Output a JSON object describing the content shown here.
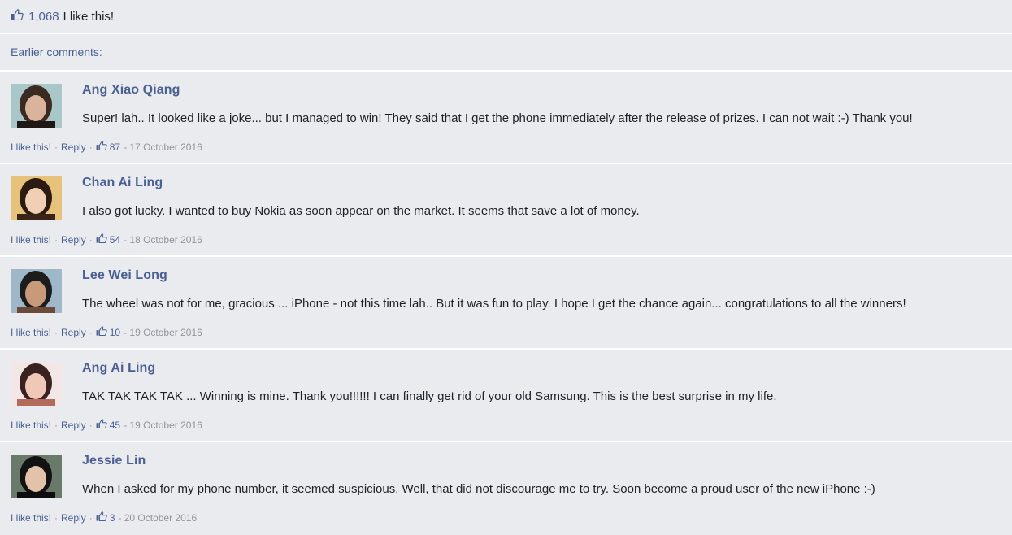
{
  "top_likes": {
    "count": "1,068",
    "text": "I like this!"
  },
  "earlier_label": "Earlier comments:",
  "comments": [
    {
      "name": "Ang Xiao Qiang",
      "text": "Super! lah.. It looked like a joke... but I managed to win! They said that I get the phone immediately after the release of prizes. I can not wait :-) Thank you!",
      "like_label": "I like this!",
      "reply_label": "Reply",
      "likes": "87",
      "date": "- 17 October 2016",
      "avatar_colors": [
        "#a9c6c9",
        "#3b2a22",
        "#d9b39b",
        "#1f1815"
      ]
    },
    {
      "name": "Chan Ai Ling",
      "text": "I also got lucky. I wanted to buy Nokia as soon appear on the market. It seems that save a lot of money.",
      "like_label": "I like this!",
      "reply_label": "Reply",
      "likes": "54",
      "date": "- 18 October 2016",
      "avatar_colors": [
        "#e6c27a",
        "#2a1a12",
        "#f1cfb4",
        "#3a2418"
      ]
    },
    {
      "name": "Lee Wei Long",
      "text": "The wheel was not for me, gracious ... iPhone - not this time lah.. But it was fun to play. I hope I get the chance again... congratulations to all the winners!",
      "like_label": "I like this!",
      "reply_label": "Reply",
      "likes": "10",
      "date": "- 19 October 2016",
      "avatar_colors": [
        "#9fb8c9",
        "#1c1c1c",
        "#c99a7a",
        "#6b4a3a"
      ]
    },
    {
      "name": "Ang Ai Ling",
      "text": "TAK TAK TAK TAK ... Winning is mine. Thank you!!!!!! I can finally get rid of your old Samsung. This is the best surprise in my life.",
      "like_label": "I like this!",
      "reply_label": "Reply",
      "likes": "45",
      "date": "- 19 October 2016",
      "avatar_colors": [
        "#f2e6e6",
        "#3a2220",
        "#f0c8b8",
        "#b46a5a"
      ]
    },
    {
      "name": "Jessie Lin",
      "text": "When I asked for my phone number, it seemed suspicious. Well, that did not discourage me to try. Soon become a proud user of the new iPhone :-)",
      "like_label": "I like this!",
      "reply_label": "Reply",
      "likes": "3",
      "date": "- 20 October 2016",
      "avatar_colors": [
        "#6a7a6a",
        "#121212",
        "#e3c2aa",
        "#0d0d0d"
      ]
    }
  ]
}
